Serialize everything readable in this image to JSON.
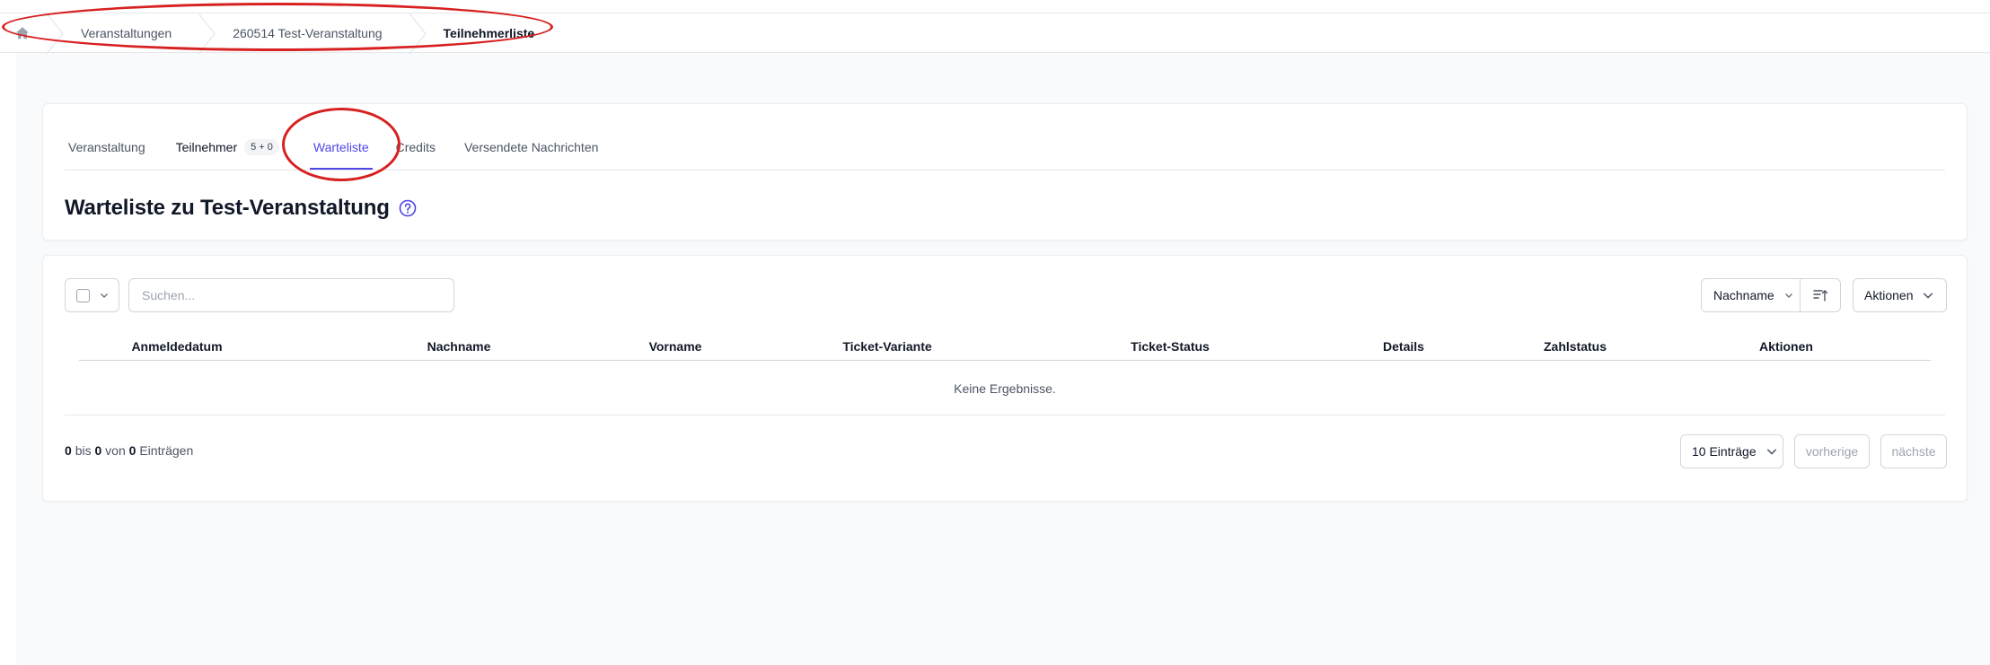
{
  "breadcrumb": {
    "home_icon": "home-icon",
    "items": [
      {
        "label": "Veranstaltungen"
      },
      {
        "label": "260514 Test-Veranstaltung"
      },
      {
        "label": "Teilnehmerliste"
      }
    ]
  },
  "tabs": [
    {
      "label": "Veranstaltung"
    },
    {
      "label": "Teilnehmer",
      "badge": "5 + 0"
    },
    {
      "label": "Warteliste",
      "active": true
    },
    {
      "label": "Credits"
    },
    {
      "label": "Versendete Nachrichten"
    }
  ],
  "page_title": "Warteliste zu Test-Veranstaltung",
  "toolbar": {
    "search_placeholder": "Suchen...",
    "sort_label": "Nachname",
    "actions_label": "Aktionen"
  },
  "table": {
    "columns": [
      "Anmeldedatum",
      "Nachname",
      "Vorname",
      "Ticket-Variante",
      "Ticket-Status",
      "Details",
      "Zahlstatus",
      "Aktionen"
    ],
    "empty_text": "Keine Ergebnisse."
  },
  "pagination": {
    "from": "0",
    "to": "0",
    "total": "0",
    "text_bis": "bis",
    "text_von": "von",
    "text_entries": "Einträgen",
    "page_size_label": "10 Einträge",
    "prev_label": "vorherige",
    "next_label": "nächste"
  },
  "colors": {
    "accent": "#4f46e5",
    "highlight": "#d72020"
  }
}
